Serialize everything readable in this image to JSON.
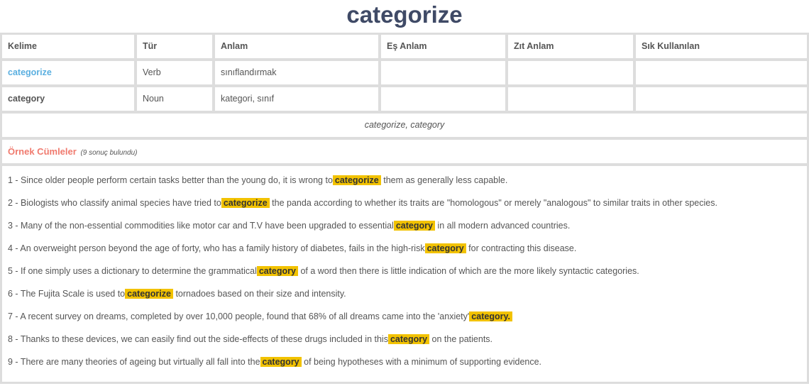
{
  "page_title": "categorize",
  "table": {
    "headers": [
      "Kelime",
      "Tür",
      "Anlam",
      "Eş Anlam",
      "Zıt Anlam",
      "Sık Kullanılan"
    ],
    "rows": [
      {
        "word": "categorize",
        "type": "Verb",
        "meaning": "sınıflandırmak",
        "synonym": "",
        "antonym": "",
        "frequent": ""
      },
      {
        "word": "category",
        "type": "Noun",
        "meaning": "kategori, sınıf",
        "synonym": "",
        "antonym": "",
        "frequent": ""
      }
    ]
  },
  "related_words": "categorize, category",
  "examples": {
    "label": "Örnek Cümleler",
    "count_text": "(9 sonuç bulundu)",
    "sentences": [
      {
        "before": "1 - Since older people perform certain tasks better than the young do, it is wrong to",
        "highlight": "categorize",
        "after": "them as generally less capable."
      },
      {
        "before": "2 - Biologists who classify animal species have tried to",
        "highlight": "categorize",
        "after": "the panda according to whether its traits are \"homologous\" or merely \"analogous\" to similar traits in other species."
      },
      {
        "before": "3 - Many of the non-essential commodities like motor car and T.V have been upgraded to essential",
        "highlight": "category",
        "after": "in all modern advanced countries."
      },
      {
        "before": "4 - An overweight person beyond the age of forty, who has a family history of diabetes, fails in the high-risk",
        "highlight": "category",
        "after": "for contracting this disease."
      },
      {
        "before": "5 - If one simply uses a dictionary to determine the grammatical",
        "highlight": "category",
        "after": "of a word then there is little indication of which are the more likely syntactic categories."
      },
      {
        "before": "6 - The Fujita Scale is used to",
        "highlight": "categorize",
        "after": "tornadoes based on their size and intensity."
      },
      {
        "before": "7 - A recent survey on dreams, completed by over 10,000 people, found that 68% of all dreams came into the 'anxiety'",
        "highlight": "category.",
        "after": ""
      },
      {
        "before": "8 - Thanks to these devices, we can easily find out the side-effects of these drugs included in this",
        "highlight": "category",
        "after": "on the patients."
      },
      {
        "before": "9 - There are many theories of ageing but virtually all fall into the",
        "highlight": "category",
        "after": "of being hypotheses with a minimum of supporting evidence."
      }
    ]
  },
  "colors": {
    "highlight": "#f2c200",
    "link": "#5aafe0",
    "examples_label": "#f07a6e",
    "title": "#3f4a66"
  }
}
